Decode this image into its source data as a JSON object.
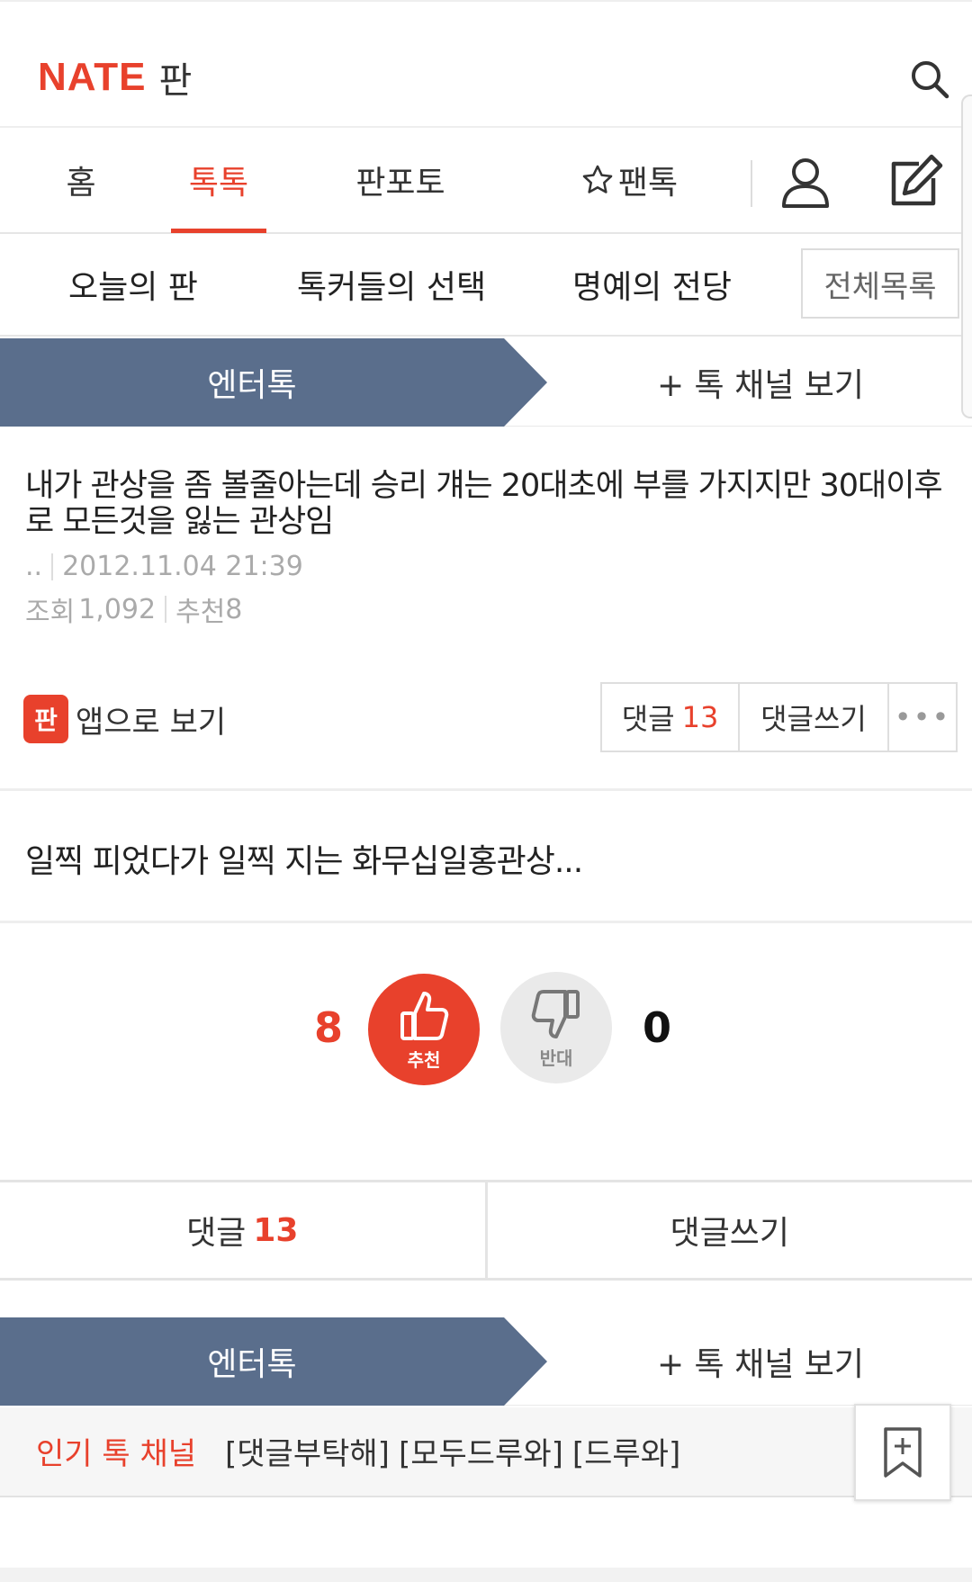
{
  "header": {
    "logo_brand": "NATE",
    "logo_service": "판"
  },
  "nav": {
    "tabs": [
      {
        "label": "홈"
      },
      {
        "label": "톡톡"
      },
      {
        "label": "판포토"
      },
      {
        "label": "팬톡"
      }
    ],
    "active_tab": "톡톡"
  },
  "subnav": {
    "items": [
      "오늘의 판",
      "톡커들의 선택",
      "명예의 전당"
    ],
    "all_list_label": "전체목록"
  },
  "channel": {
    "name": "엔터톡",
    "more_label": "+ 톡 채널 보기"
  },
  "article": {
    "title": "내가 관상을 좀 볼줄아는데 승리 걔는 20대초에 부를 가지지만 30대이후로 모든것을 잃는 관상임",
    "author": "..",
    "datetime": "2012.11.04 21:39",
    "views_label": "조회",
    "views": "1,092",
    "recommend_label": "추천",
    "recommend": "8",
    "body": "일찍 피었다가 일찍 지는 화무십일홍관상..."
  },
  "actions": {
    "app_icon_text": "판",
    "app_view_label": "앱으로 보기",
    "comments_label": "댓글",
    "comments_count": "13",
    "write_label": "댓글쓰기",
    "more_label": "•••"
  },
  "votes": {
    "up_count": "8",
    "up_label": "추천",
    "down_count": "0",
    "down_label": "반대"
  },
  "comment_bar": {
    "comments_label": "댓글",
    "comments_count": "13",
    "write_label": "댓글쓰기"
  },
  "popular": {
    "label": "인기 톡 채널",
    "channels": [
      "[댓글부탁해]",
      "[모두드루와]",
      "[드루와]"
    ]
  },
  "colors": {
    "brand_red": "#e8412c",
    "channel_bar": "#5a6e8c",
    "down_vote_bg": "#eaeaea"
  }
}
